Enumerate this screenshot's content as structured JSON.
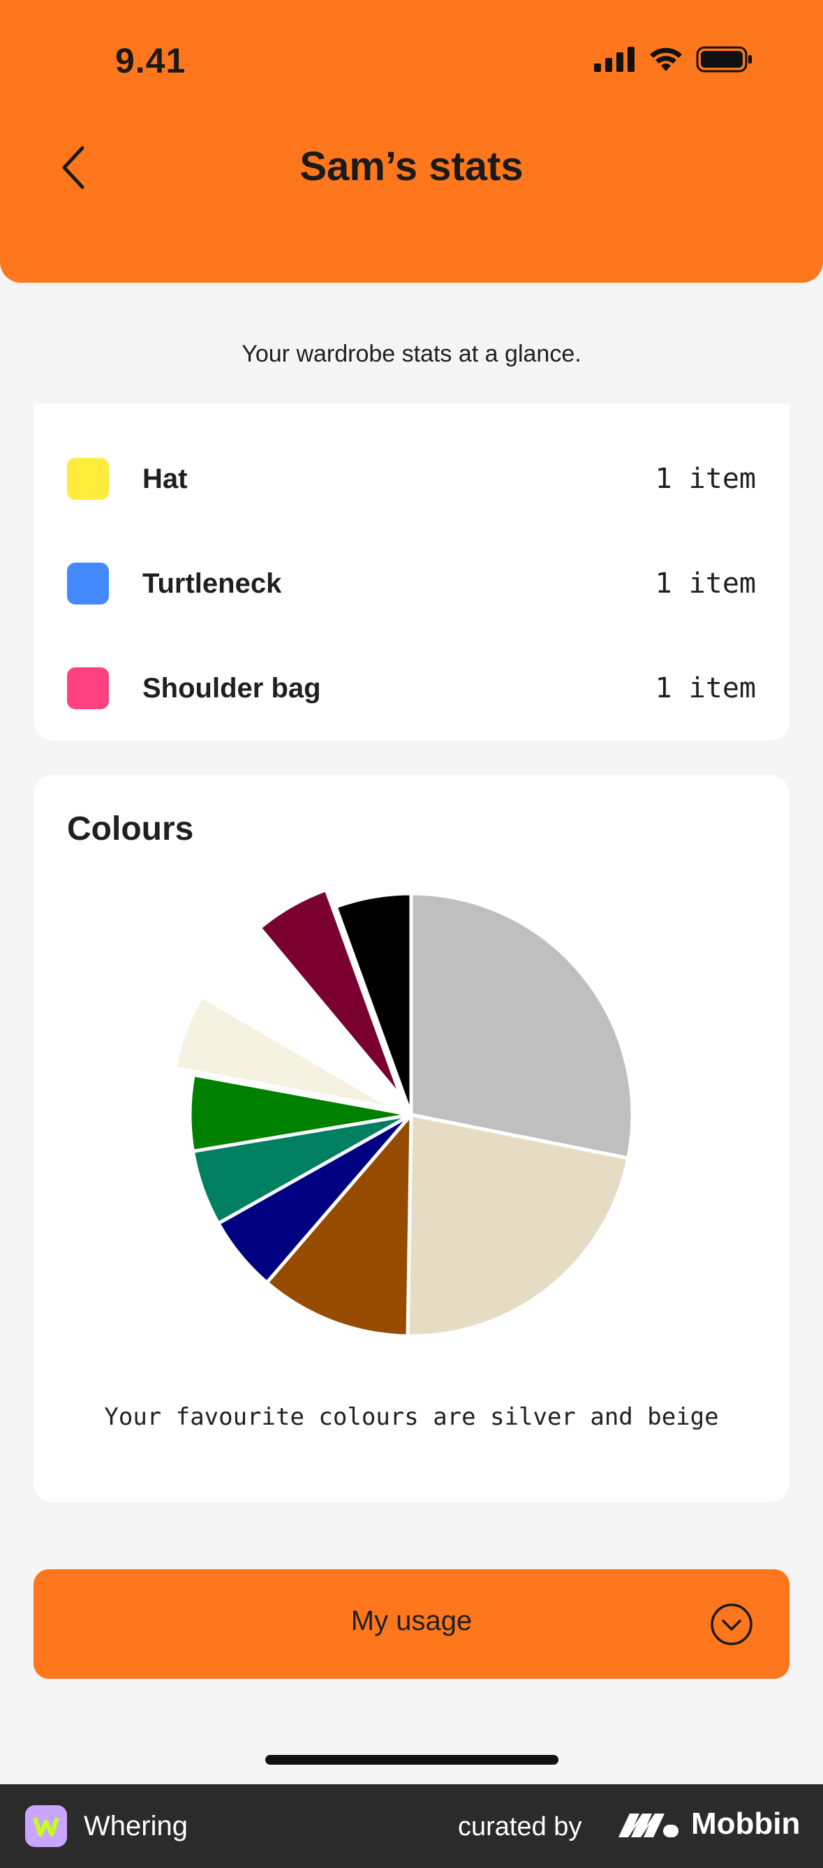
{
  "status_bar": {
    "time": "9.41"
  },
  "header": {
    "title": "Sam’s stats"
  },
  "subtitle": "Your wardrobe stats at a glance.",
  "items": [
    {
      "name": "Hat",
      "count": "1 item",
      "color": "#ffeb3b"
    },
    {
      "name": "Turtleneck",
      "count": "1 item",
      "color": "#448aff"
    },
    {
      "name": "Shoulder bag",
      "count": "1 item",
      "color": "#ff4081"
    }
  ],
  "colours": {
    "title": "Colours",
    "summary": "Your favourite colours are silver and beige"
  },
  "chart_data": {
    "type": "pie",
    "categories": [
      "silver",
      "beige",
      "brown",
      "navy",
      "teal",
      "green",
      "cream",
      "white",
      "burgundy",
      "black"
    ],
    "values": [
      28,
      22,
      11,
      5.5,
      5.5,
      5.5,
      5.5,
      5.5,
      5.5,
      5.5
    ],
    "colors": [
      "#bfbfbf",
      "#e6dcc4",
      "#964b00",
      "#000080",
      "#008060",
      "#008000",
      "#f5f2e2",
      "#ffffff",
      "#7a0030",
      "#000000"
    ],
    "exploded": [
      "cream",
      "burgundy"
    ]
  },
  "usage_button": {
    "label": "My usage"
  },
  "footer": {
    "app_name": "Whering",
    "curated_by": "curated by",
    "brand": "Mobbin"
  }
}
